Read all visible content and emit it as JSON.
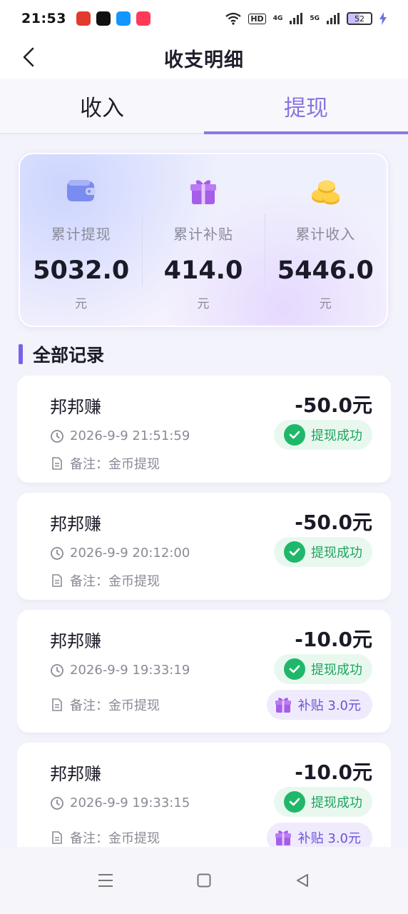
{
  "status_bar": {
    "time": "21:53",
    "hd_label": "HD",
    "net_4g": "4G",
    "net_5g": "5G",
    "battery": "52",
    "app_colors": [
      "#e23b2e",
      "#111111",
      "#1296ff",
      "#ff3b57"
    ]
  },
  "header": {
    "title": "收支明细",
    "back_icon": "chevron-left-icon"
  },
  "tabs": [
    {
      "label": "收入",
      "active": false
    },
    {
      "label": "提现",
      "active": true
    }
  ],
  "summary": {
    "items": [
      {
        "label": "累计提现",
        "value": "5032.0",
        "unit": "元",
        "icon": "wallet-icon"
      },
      {
        "label": "累计补贴",
        "value": "414.0",
        "unit": "元",
        "icon": "gift-icon"
      },
      {
        "label": "累计收入",
        "value": "5446.0",
        "unit": "元",
        "icon": "coins-icon"
      }
    ]
  },
  "section": {
    "title": "全部记录"
  },
  "records": [
    {
      "name": "邦邦赚",
      "amount": "-50.0元",
      "time": "2026-9-9 21:51:59",
      "note_label": "备注：",
      "note_value": "金币提现",
      "status": "提现成功",
      "subsidy": ""
    },
    {
      "name": "邦邦赚",
      "amount": "-50.0元",
      "time": "2026-9-9 20:12:00",
      "note_label": "备注：",
      "note_value": "金币提现",
      "status": "提现成功",
      "subsidy": ""
    },
    {
      "name": "邦邦赚",
      "amount": "-10.0元",
      "time": "2026-9-9 19:33:19",
      "note_label": "备注：",
      "note_value": "金币提现",
      "status": "提现成功",
      "subsidy": "补贴 3.0元"
    },
    {
      "name": "邦邦赚",
      "amount": "-10.0元",
      "time": "2026-9-9 19:33:15",
      "note_label": "备注：",
      "note_value": "金币提现",
      "status": "提现成功",
      "subsidy": "补贴 3.0元"
    }
  ],
  "colors": {
    "accent": "#8b78e6",
    "success": "#1fb86a",
    "subsidy": "#6b53d6"
  }
}
